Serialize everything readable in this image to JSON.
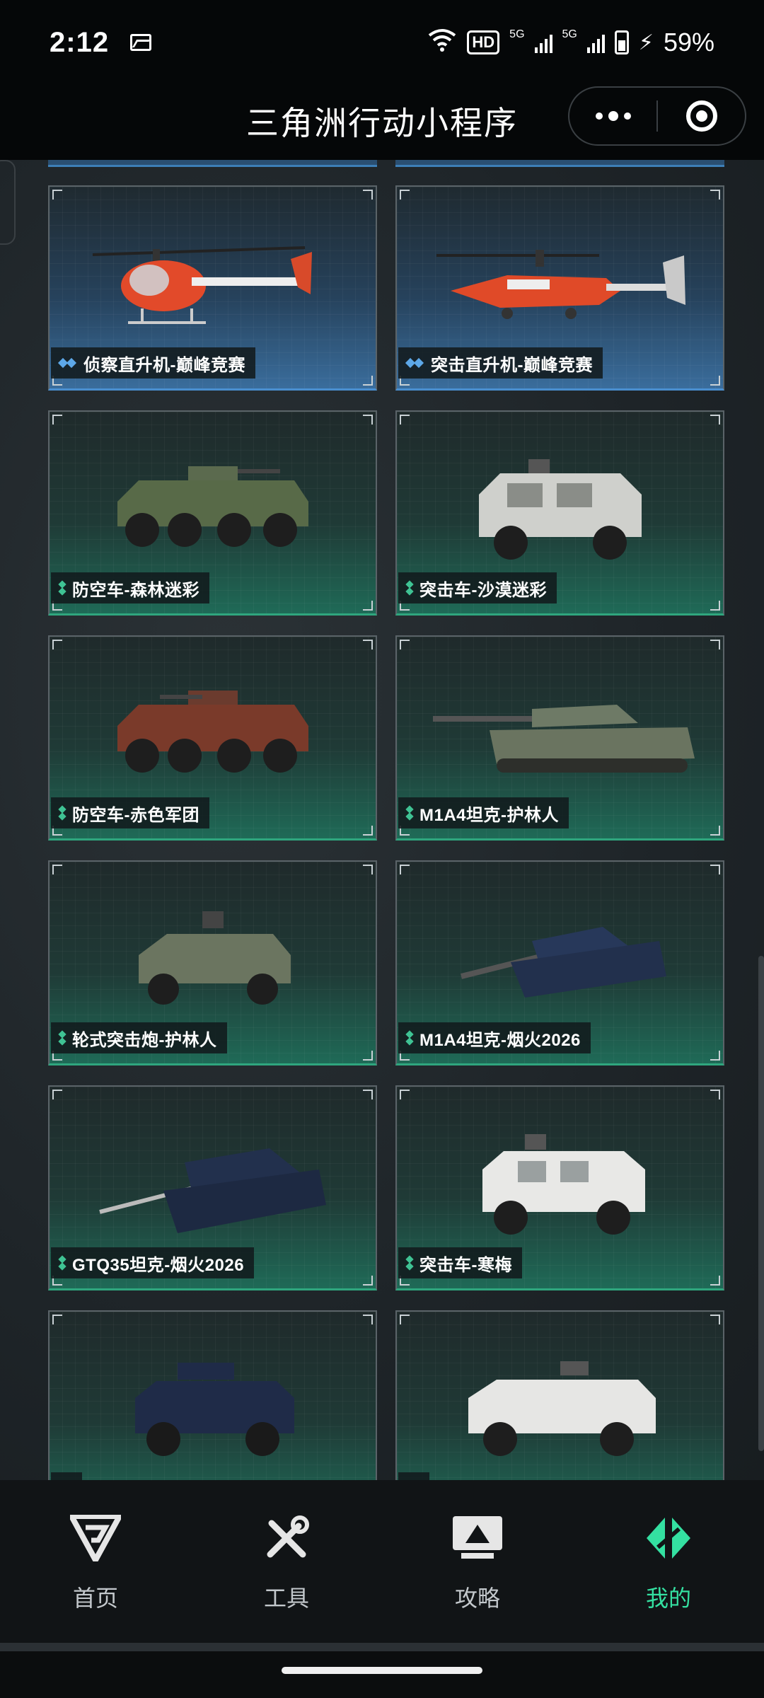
{
  "status_bar": {
    "time": "2:12",
    "network_label": "HD",
    "network_sub": "5G",
    "battery_text": "59%",
    "icons": [
      "gallery-icon",
      "wifi-icon",
      "signal-icon",
      "battery-icon",
      "charging-icon"
    ]
  },
  "header": {
    "title": "三角洲行动小程序",
    "more_icon": "more-dots-icon",
    "close_icon": "target-circle-icon"
  },
  "cards": [
    {
      "label": "侦察直升机-巅峰竞赛",
      "rarity": "blue",
      "vehicle": "helicopter-scout"
    },
    {
      "label": "突击直升机-巅峰竞赛",
      "rarity": "blue",
      "vehicle": "helicopter-attack"
    },
    {
      "label": "防空车-森林迷彩",
      "rarity": "green",
      "vehicle": "apc-forest"
    },
    {
      "label": "突击车-沙漠迷彩",
      "rarity": "green",
      "vehicle": "assault-desert"
    },
    {
      "label": "防空车-赤色军团",
      "rarity": "green",
      "vehicle": "apc-red"
    },
    {
      "label": "M1A4坦克-护林人",
      "rarity": "green",
      "vehicle": "tank-camo"
    },
    {
      "label": "轮式突击炮-护林人",
      "rarity": "green",
      "vehicle": "wheeled-camo"
    },
    {
      "label": "M1A4坦克-烟火2026",
      "rarity": "green",
      "vehicle": "tank-navy"
    },
    {
      "label": "GTQ35坦克-烟火2026",
      "rarity": "green",
      "vehicle": "tank-navy-2"
    },
    {
      "label": "突击车-寒梅",
      "rarity": "green",
      "vehicle": "assault-white"
    },
    {
      "label": "",
      "rarity": "green",
      "vehicle": "buggy-navy"
    },
    {
      "label": "",
      "rarity": "green",
      "vehicle": "assault-white-2"
    }
  ],
  "bottom_nav": [
    {
      "label": "首页",
      "icon": "home-g-logo-icon",
      "active": false
    },
    {
      "label": "工具",
      "icon": "tools-icon",
      "active": false
    },
    {
      "label": "攻略",
      "icon": "guide-monitor-icon",
      "active": false
    },
    {
      "label": "我的",
      "icon": "profile-logo-icon",
      "active": true
    }
  ],
  "colors": {
    "accent": "#34e0a1",
    "green_rarity": "#2fa67e",
    "blue_rarity": "#4a8fd0",
    "background": "#1c2226"
  }
}
